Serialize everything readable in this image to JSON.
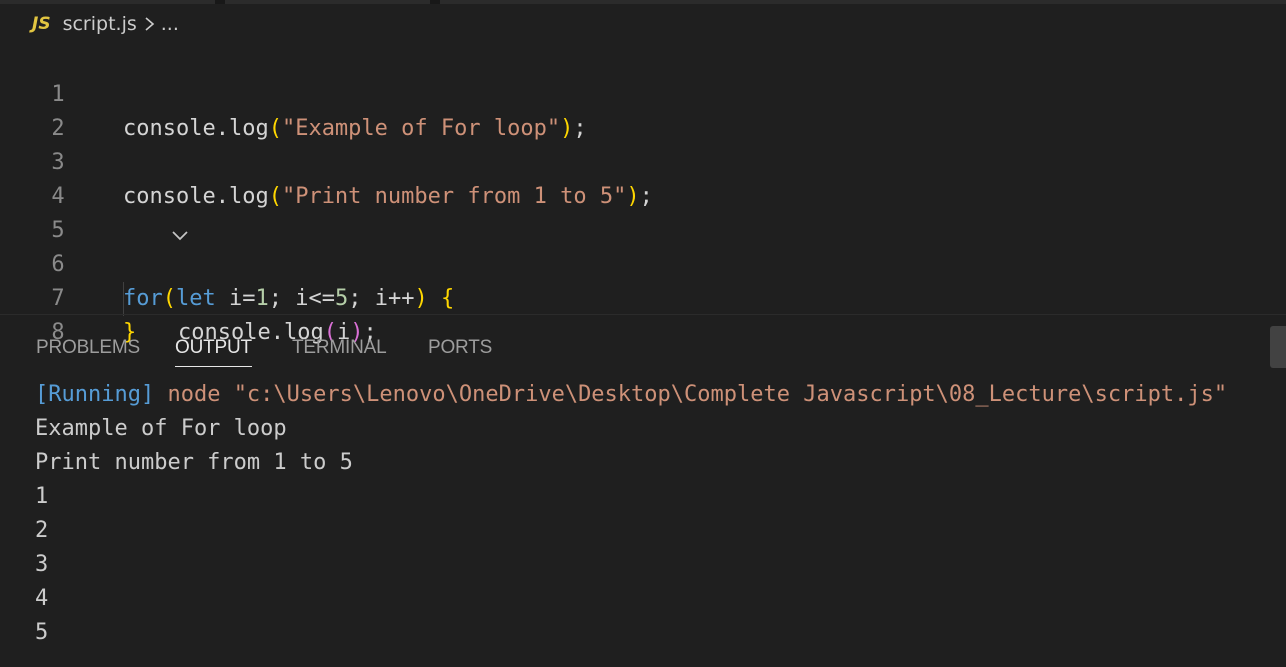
{
  "breadcrumb": {
    "language_badge": "JS",
    "file": "script.js",
    "separator_icon": "chevron-right-icon",
    "more": "..."
  },
  "editor": {
    "lines": [
      {
        "number": "1"
      },
      {
        "number": "2"
      },
      {
        "number": "3"
      },
      {
        "number": "4"
      },
      {
        "number": "5",
        "folding": "chevron-down-icon"
      },
      {
        "number": "6"
      },
      {
        "number": "7"
      },
      {
        "number": "8"
      }
    ],
    "tokens": {
      "l1_a": "console.log",
      "l1_b": "(",
      "l1_c": "\"Example of For loop\"",
      "l1_d": ")",
      "l1_e": ";",
      "l3_a": "console.log",
      "l3_b": "(",
      "l3_c": "\"Print number from 1 to 5\"",
      "l3_d": ")",
      "l3_e": ";",
      "l5_for": "for",
      "l5_paren_open": "(",
      "l5_let": "let",
      "l5_i1": " i=",
      "l5_n1": "1",
      "l5_mid1": "; i<=",
      "l5_n5": "5",
      "l5_mid2": "; i++",
      "l5_paren_close": ")",
      "l5_space": " ",
      "l5_brace": "{",
      "l6_a": "console.log",
      "l6_b": "(",
      "l6_c": "i",
      "l6_d": ")",
      "l6_e": ";",
      "l7_brace": "}"
    }
  },
  "panel": {
    "tabs": [
      {
        "label": "PROBLEMS",
        "active": false
      },
      {
        "label": "OUTPUT",
        "active": true
      },
      {
        "label": "TERMINAL",
        "active": false
      },
      {
        "label": "PORTS",
        "active": false
      }
    ],
    "output": {
      "running_tag": "[Running]",
      "command": " node \"c:\\Users\\Lenovo\\OneDrive\\Desktop\\Complete Javascript\\08_Lecture\\script.js\"",
      "lines": [
        "Example of For loop",
        "Print number from 1 to 5",
        "1",
        "2",
        "3",
        "4",
        "5"
      ]
    }
  },
  "colors": {
    "background": "#1f1f1f",
    "string": "#ce9178",
    "keyword": "#569cd6",
    "number": "#b5cea8",
    "bracket_level1": "#ffd700",
    "bracket_level2": "#da70d6",
    "js_badge": "#e2c541"
  }
}
